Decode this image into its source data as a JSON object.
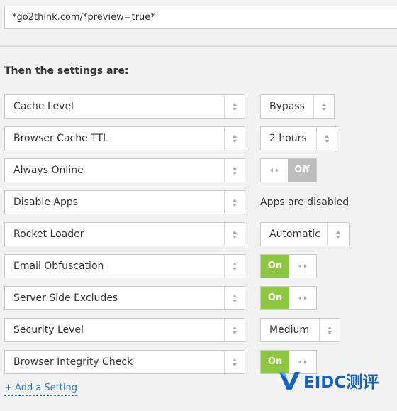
{
  "url_pattern": "*go2think.com/*preview=true*",
  "settings_heading": "Then the settings are:",
  "rows": [
    {
      "label": "Cache Level",
      "type": "select",
      "value": "Bypass"
    },
    {
      "label": "Browser Cache TTL",
      "type": "select",
      "value": "2 hours"
    },
    {
      "label": "Always Online",
      "type": "toggle",
      "state": "off",
      "value": "Off"
    },
    {
      "label": "Disable Apps",
      "type": "text",
      "value": "Apps are disabled"
    },
    {
      "label": "Rocket Loader",
      "type": "select",
      "value": "Automatic"
    },
    {
      "label": "Email Obfuscation",
      "type": "toggle",
      "state": "on",
      "value": "On"
    },
    {
      "label": "Server Side Excludes",
      "type": "toggle",
      "state": "on",
      "value": "On"
    },
    {
      "label": "Security Level",
      "type": "select",
      "value": "Medium"
    },
    {
      "label": "Browser Integrity Check",
      "type": "toggle",
      "state": "on",
      "value": "On"
    }
  ],
  "add_setting_label": "+ Add a Setting",
  "watermark": "EIDC测评",
  "colors": {
    "toggle_on": "#8dc63f",
    "toggle_off": "#bdbdbd",
    "link": "#2f7bbf",
    "watermark": "#1565c0"
  }
}
